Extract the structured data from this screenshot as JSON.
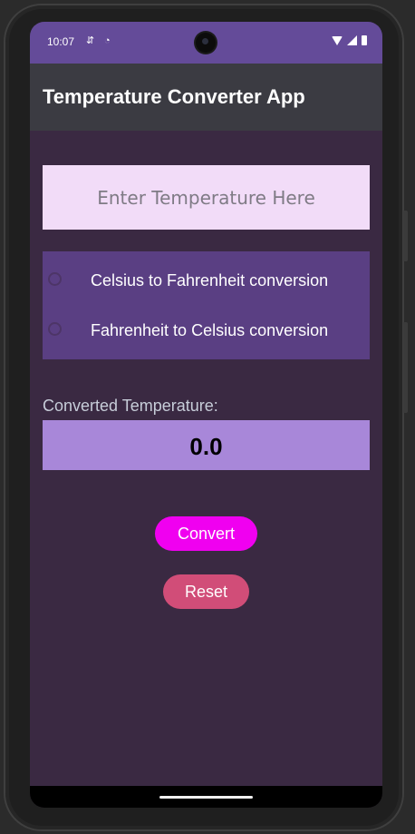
{
  "status_bar": {
    "time": "10:07",
    "icons_left": [
      "data-saver-icon",
      "circle-face-icon"
    ],
    "icons_right": [
      "wifi-icon",
      "signal-icon",
      "battery-icon"
    ]
  },
  "app_bar": {
    "title": "Temperature Converter App"
  },
  "temperature_input": {
    "value": "",
    "placeholder": "Enter Temperature Here"
  },
  "conversion_options": [
    {
      "label": "Celsius to Fahrenheit conversion",
      "selected": false
    },
    {
      "label": "Fahrenheit to Celsius conversion",
      "selected": false
    }
  ],
  "result": {
    "label": "Converted Temperature:",
    "value": "0.0"
  },
  "buttons": {
    "convert_label": "Convert",
    "reset_label": "Reset"
  },
  "colors": {
    "status_bar": "#644b99",
    "app_bar": "#3b3b42",
    "background": "#3a2942",
    "input_background": "#f2dcf8",
    "radio_group_background": "#5a3f83",
    "result_background": "#a887d9",
    "convert_button": "#f000f0",
    "reset_button": "#d14d78"
  }
}
